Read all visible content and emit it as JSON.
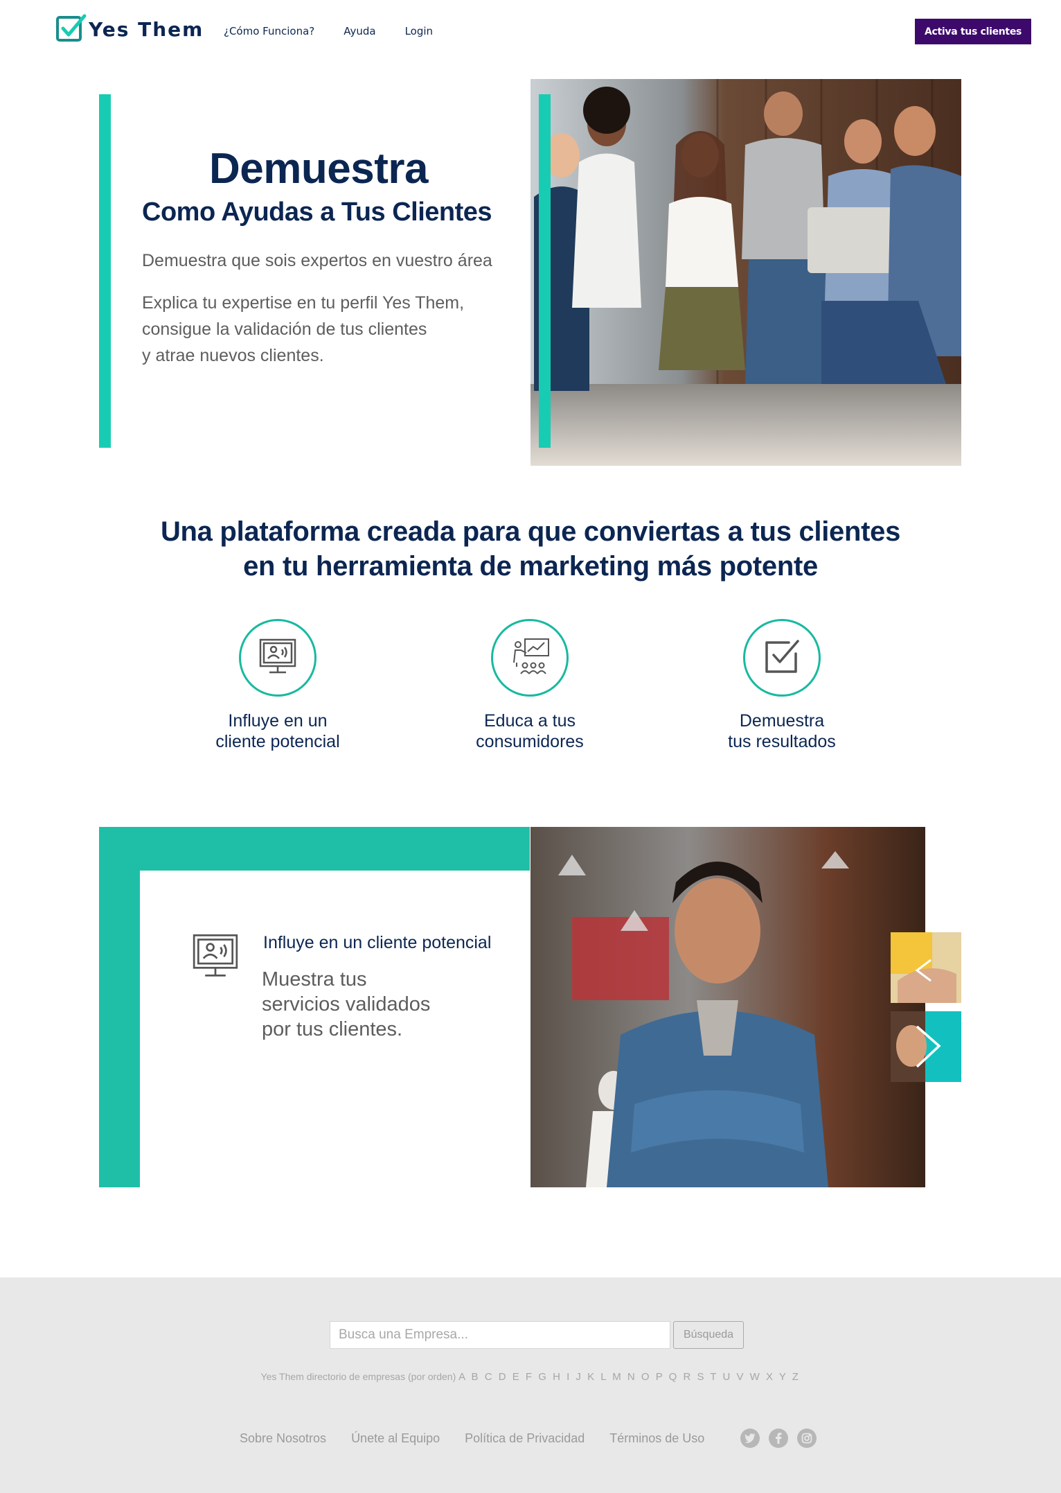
{
  "header": {
    "logo_text": "Yes Them",
    "nav": [
      "¿Cómo Funciona?",
      "Ayuda",
      "Login"
    ],
    "cta_label": "Activa tus clientes"
  },
  "hero": {
    "title": "Demuestra",
    "subtitle": "Como Ayudas a Tus Clientes",
    "paragraph1": "Demuestra que sois expertos en vuestro área",
    "paragraph2_lines": [
      "Explica tu expertise en tu perfil Yes Them,",
      "consigue la validación de tus clientes",
      "y atrae nuevos clientes."
    ]
  },
  "platform": {
    "title_lines": [
      "Una plataforma creada para que conviertas a tus clientes",
      "en tu herramienta de marketing más potente"
    ],
    "features": [
      {
        "icon": "presentation-screen-icon",
        "label_lines": [
          "Influye en un",
          "cliente potencial"
        ]
      },
      {
        "icon": "teaching-audience-icon",
        "label_lines": [
          "Educa a tus",
          "consumidores"
        ]
      },
      {
        "icon": "checkbox-icon",
        "label_lines": [
          "Demuestra",
          "tus resultados"
        ]
      }
    ]
  },
  "carousel": {
    "heading": "Influye en un cliente potencial",
    "text_lines": [
      "Muestra tus",
      "servicios validados",
      "por tus clientes."
    ]
  },
  "footer": {
    "search_placeholder": "Busca una Empresa...",
    "search_button": "Búsqueda",
    "directory_label": "Yes Them directorio de empresas (por orden)",
    "letters": [
      "A",
      "B",
      "C",
      "D",
      "E",
      "F",
      "G",
      "H",
      "I",
      "J",
      "K",
      "L",
      "M",
      "N",
      "O",
      "P",
      "Q",
      "R",
      "S",
      "T",
      "U",
      "V",
      "W",
      "X",
      "Y",
      "Z"
    ],
    "links": [
      "Sobre Nosotros",
      "Únete al Equipo",
      "Política de Privacidad",
      "Términos de Uso"
    ],
    "social": [
      "twitter-icon",
      "facebook-icon",
      "instagram-icon"
    ]
  },
  "colors": {
    "navy": "#0c2652",
    "teal": "#18ccb3",
    "purple": "#3d0a6b",
    "footer_bg": "#e8e8e8"
  }
}
